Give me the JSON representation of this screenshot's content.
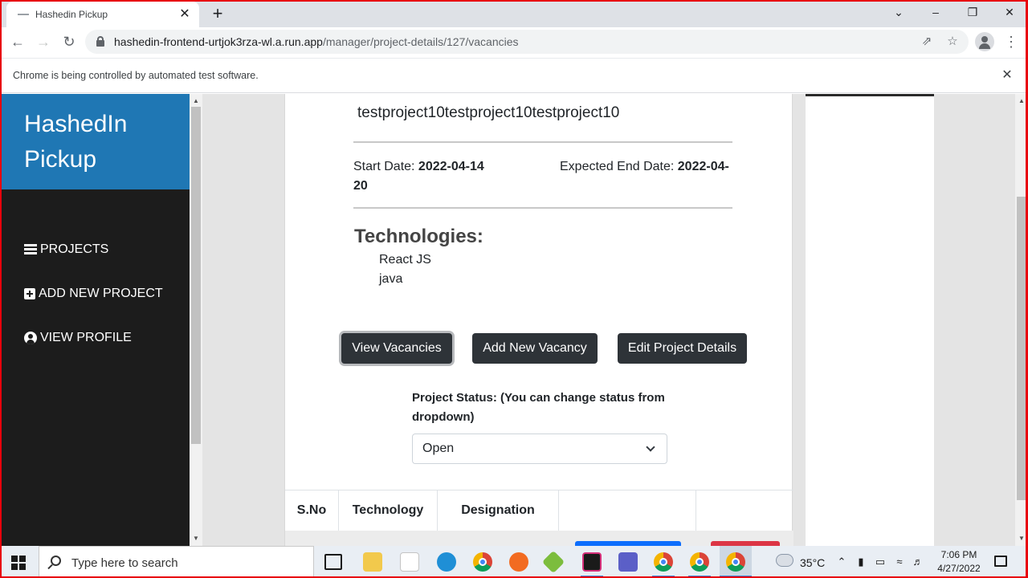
{
  "browser": {
    "tab_title": "Hashedin Pickup",
    "tab_close": "✕",
    "new_tab": "+",
    "url_host": "hashedin-frontend-urtjok3rza-wl.a.run.app",
    "url_path": "/manager/project-details/127/vacancies",
    "infobar_text": "Chrome is being controlled by automated test software.",
    "controls": {
      "chevron": "⌄",
      "minimize": "–",
      "restore": "❐",
      "close": "✕"
    }
  },
  "sidebar": {
    "brand": "HashedIn Pickup",
    "items": [
      {
        "label": "PROJECTS",
        "icon": "list-icon"
      },
      {
        "label": "ADD NEW PROJECT",
        "icon": "plus-square-icon"
      },
      {
        "label": "VIEW PROFILE",
        "icon": "user-circle-icon"
      }
    ]
  },
  "project": {
    "name": "testproject10testproject10testproject10",
    "start_label": "Start Date: ",
    "start_date": "2022-04-14",
    "end_label": "Expected End Date: ",
    "end_date_part1": "2022-04-",
    "end_date_part2": "20",
    "technologies_heading": "Technologies:",
    "technologies": [
      "React JS",
      "java"
    ]
  },
  "actions": {
    "view_vacancies": "View Vacancies",
    "add_vacancy": "Add New Vacancy",
    "edit_project": "Edit Project Details"
  },
  "status": {
    "label": "Project Status: (You can change status from dropdown)",
    "selected": "Open"
  },
  "table": {
    "headers": [
      "S.No",
      "Technology",
      "Designation",
      "",
      ""
    ]
  },
  "taskbar": {
    "search_placeholder": "Type here to search",
    "weather": "35°C",
    "time": "7:06 PM",
    "date": "4/27/2022"
  },
  "colors": {
    "brand_blue": "#1f77b4",
    "sidebar_bg": "#1c1c1c",
    "button_dark": "#2e3338",
    "row_button_blue": "#0d6efd",
    "row_button_red": "#dc3545",
    "frame_red": "#e8000b"
  }
}
